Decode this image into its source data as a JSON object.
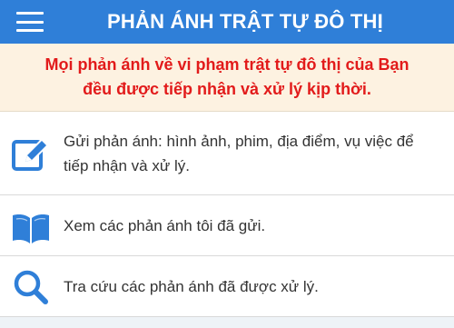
{
  "app_bar": {
    "title": "PHẢN ÁNH TRẬT TỰ ĐÔ THỊ",
    "menu_icon": "hamburger-menu-icon",
    "background": "#2f7fd8"
  },
  "notice": {
    "line1": "Mọi phản ánh về vi phạm trật tự đô thị của Bạn",
    "line2": "đều được tiếp nhận và xử lý kịp thời.",
    "text_color": "#e21b1b",
    "background": "#fdf2e1"
  },
  "menu": {
    "items": [
      {
        "icon": "edit-icon",
        "line1": "Gửi phản ánh: hình ảnh, phim, địa điểm, vụ việc để",
        "line2": "tiếp nhận và xử lý."
      },
      {
        "icon": "open-book-icon",
        "label": "Xem các phản ánh tôi đã gửi."
      },
      {
        "icon": "search-icon",
        "label": "Tra cứu các phản ánh đã được xử lý."
      }
    ],
    "icon_color": "#2f7fd8"
  }
}
